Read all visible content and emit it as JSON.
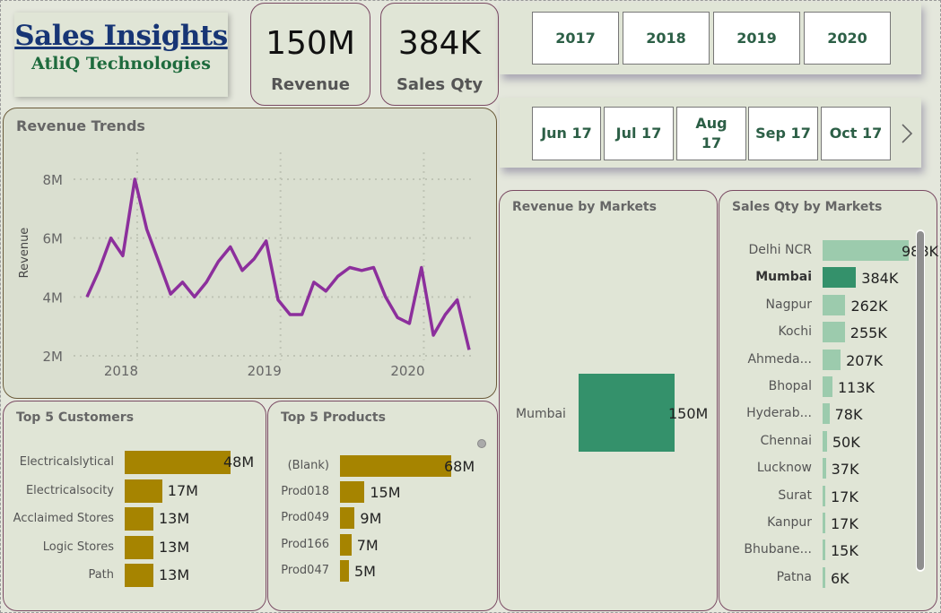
{
  "header": {
    "title": "Sales Insights",
    "subtitle": "AtliQ Technologies"
  },
  "kpis": [
    {
      "value": "150M",
      "label": "Revenue"
    },
    {
      "value": "384K",
      "label": "Sales Qty"
    }
  ],
  "year_slicer": [
    "2017",
    "2018",
    "2019",
    "2020"
  ],
  "month_slicer": [
    "Jun 17",
    "Jul 17",
    "Aug 17",
    "Sep 17",
    "Oct 17"
  ],
  "colors": {
    "line": "#8c2f9c",
    "gold": "#a68400",
    "green": "#34916b",
    "light_green": "#9ccbad"
  },
  "icons": {
    "next": "chevron-right-icon"
  },
  "revenue_trend": {
    "title": "Revenue Trends",
    "ylabel": "Revenue",
    "y_ticks": [
      "8M",
      "6M",
      "4M",
      "2M"
    ],
    "x_ticks": [
      "2018",
      "2019",
      "2020"
    ]
  },
  "market_revenue": {
    "title": "Revenue by Markets"
  },
  "market_qty": {
    "title": "Sales Qty by Markets"
  },
  "top_customers": {
    "title": "Top 5 Customers"
  },
  "top_products": {
    "title": "Top 5 Products"
  },
  "chart_data": [
    {
      "type": "line",
      "title": "Revenue Trends",
      "ylabel": "Revenue",
      "xlabel": "",
      "ylim": [
        2,
        8
      ],
      "y_unit": "M",
      "x_ticks": [
        "2018",
        "2019",
        "2020"
      ],
      "series": [
        {
          "values": [
            4.0,
            4.9,
            6.0,
            5.4,
            8.0,
            6.3,
            5.2,
            4.1,
            4.5,
            4.0,
            4.5,
            5.2,
            5.7,
            4.9,
            5.3,
            5.9,
            3.9,
            3.4,
            3.4,
            4.5,
            4.2,
            4.7,
            5.0,
            4.9,
            5.0,
            4.0,
            3.3,
            3.1,
            5.0,
            2.7,
            3.4,
            3.9,
            2.2
          ]
        }
      ]
    },
    {
      "type": "bar",
      "title": "Revenue by Markets",
      "categories": [
        "Mumbai"
      ],
      "values": [
        150
      ],
      "value_labels": [
        "150M"
      ]
    },
    {
      "type": "bar",
      "title": "Sales Qty by Markets",
      "categories": [
        "Delhi NCR",
        "Mumbai",
        "Nagpur",
        "Kochi",
        "Ahmeda...",
        "Bhopal",
        "Hyderab...",
        "Chennai",
        "Lucknow",
        "Surat",
        "Kanpur",
        "Bhubane...",
        "Patna"
      ],
      "values": [
        988,
        384,
        262,
        255,
        207,
        113,
        78,
        50,
        37,
        17,
        17,
        15,
        6
      ],
      "value_labels": [
        "988K",
        "384K",
        "262K",
        "255K",
        "207K",
        "113K",
        "78K",
        "50K",
        "37K",
        "17K",
        "17K",
        "15K",
        "6K"
      ],
      "highlight": "Mumbai"
    },
    {
      "type": "bar",
      "title": "Top 5 Customers",
      "categories": [
        "Electricalslytical",
        "Electricalsocity",
        "Acclaimed Stores",
        "Logic Stores",
        "Path"
      ],
      "values": [
        48,
        17,
        13,
        13,
        13
      ],
      "value_labels": [
        "48M",
        "17M",
        "13M",
        "13M",
        "13M"
      ]
    },
    {
      "type": "bar",
      "title": "Top 5 Products",
      "categories": [
        "(Blank)",
        "Prod018",
        "Prod049",
        "Prod166",
        "Prod047"
      ],
      "values": [
        68,
        15,
        9,
        7,
        5
      ],
      "value_labels": [
        "68M",
        "15M",
        "9M",
        "7M",
        "5M"
      ]
    }
  ]
}
